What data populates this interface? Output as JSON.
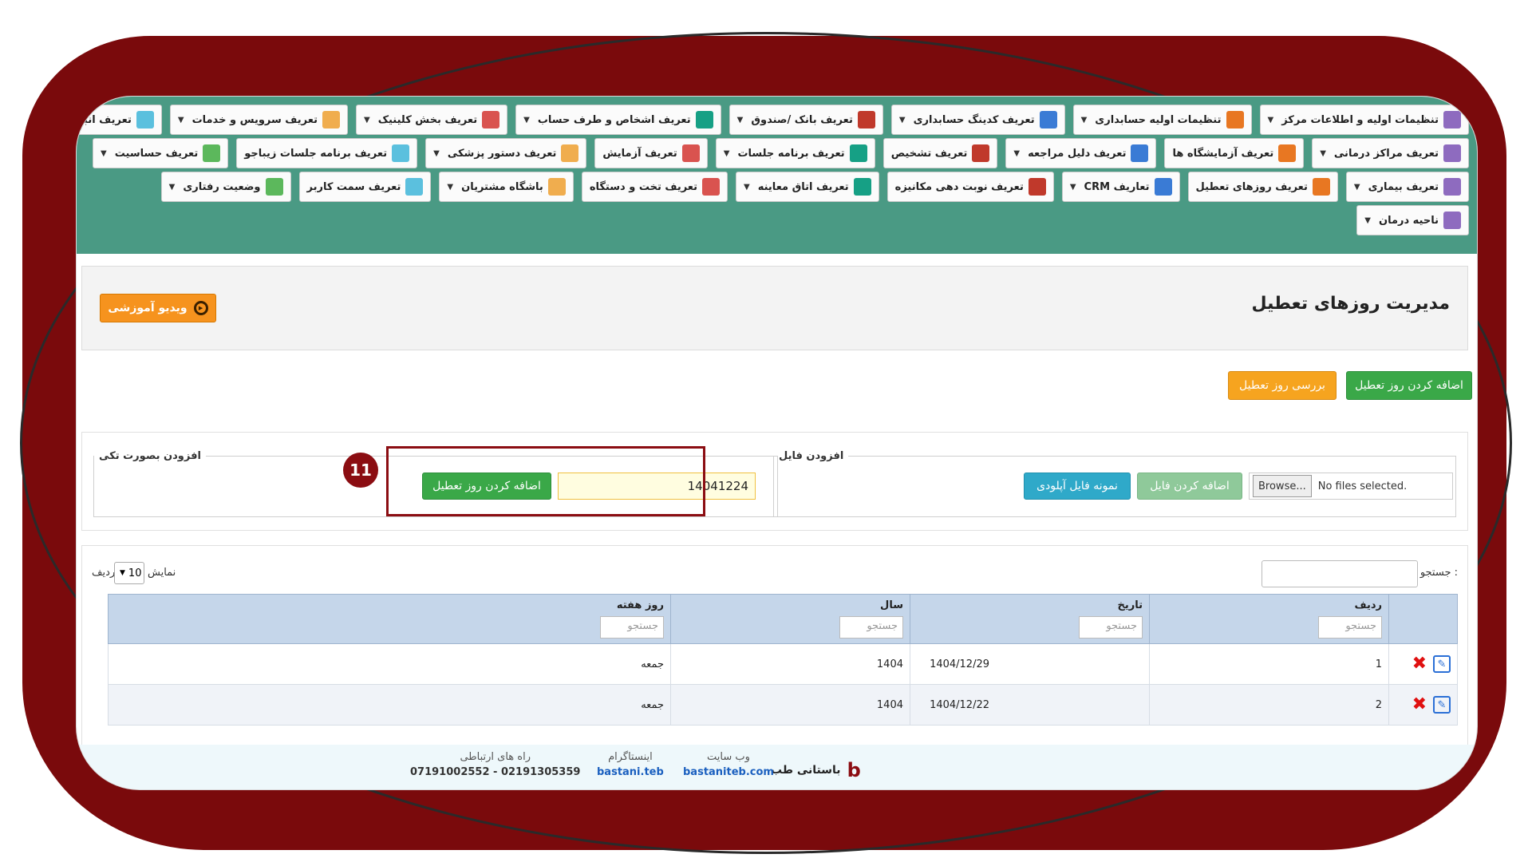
{
  "menu": {
    "row1": [
      "تنظیمات اولیه و اطلاعات مرکز",
      "تنظیمات اولیه حسابداری",
      "تعریف کدینگ حسابداری",
      "تعریف بانک /صندوق",
      "تعریف اشخاص و طرف حساب",
      "تعریف بخش کلینیک",
      "تعریف سرویس و خدمات",
      "تعریف انبار و کالا"
    ],
    "row2": [
      "تعریف مراکز درمانی",
      "تعریف آزمایشگاه ها",
      "تعریف دلیل مراجعه",
      "تعریف تشخیص",
      "تعریف برنامه جلسات",
      "تعریف آزمایش",
      "تعریف دستور پزشکی",
      "تعریف برنامه جلسات زیباجو",
      "تعریف حساسیت"
    ],
    "row3": [
      "تعریف بیماری",
      "تعریف روزهای تعطیل",
      "تعاریف CRM",
      "تعریف نوبت دهی مکانیزه",
      "تعریف اتاق معاینه",
      "تعریف تخت و دستگاه",
      "باشگاه مشتریان",
      "تعریف سمت کاربر",
      "وضعیت رفتاری"
    ],
    "row4": [
      "ناحیه درمان"
    ]
  },
  "page": {
    "title": "مدیریت روزهای تعطیل",
    "video_label": "ویدیو آموزشی"
  },
  "actions": {
    "add_holiday": "اضافه کردن روز تعطیل",
    "review_holiday": "بررسی روز تعطیل"
  },
  "file_section": {
    "legend": "افزودن فایل",
    "browse": "Browse...",
    "no_file": "No files selected.",
    "add_file": "اضافه کردن فایل",
    "sample_file": "نمونه فایل آپلودی"
  },
  "single_section": {
    "legend": "افزودن بصورت تکی",
    "date_value": "14041224",
    "add_button": "اضافه کردن روز تعطیل",
    "step_number": "11"
  },
  "table_controls": {
    "search_label": "جستجو :",
    "show_label": "نمایش",
    "page_size": "10",
    "rows_label": "ردیف"
  },
  "table": {
    "headers": [
      "ردیف",
      "تاریخ",
      "سال",
      "روز هفته"
    ],
    "search_placeholder": "جستجو",
    "rows": [
      {
        "index": "1",
        "date": "1404/12/29",
        "year": "1404",
        "weekday": "جمعه"
      },
      {
        "index": "2",
        "date": "1404/12/22",
        "year": "1404",
        "weekday": "جمعه"
      }
    ]
  },
  "footer": {
    "brand": "باستانی طب",
    "website_label": "وب سایت",
    "website": "bastaniteb.com",
    "instagram_label": "اینستاگرام",
    "instagram": "bastani.teb",
    "contact_label": "راه های ارتباطی",
    "phones": "07191002552 - 02191305359"
  },
  "colors": {
    "frame": "#7a0a0c",
    "header_band": "#4a9a84",
    "highlight": "#8b0d12"
  }
}
